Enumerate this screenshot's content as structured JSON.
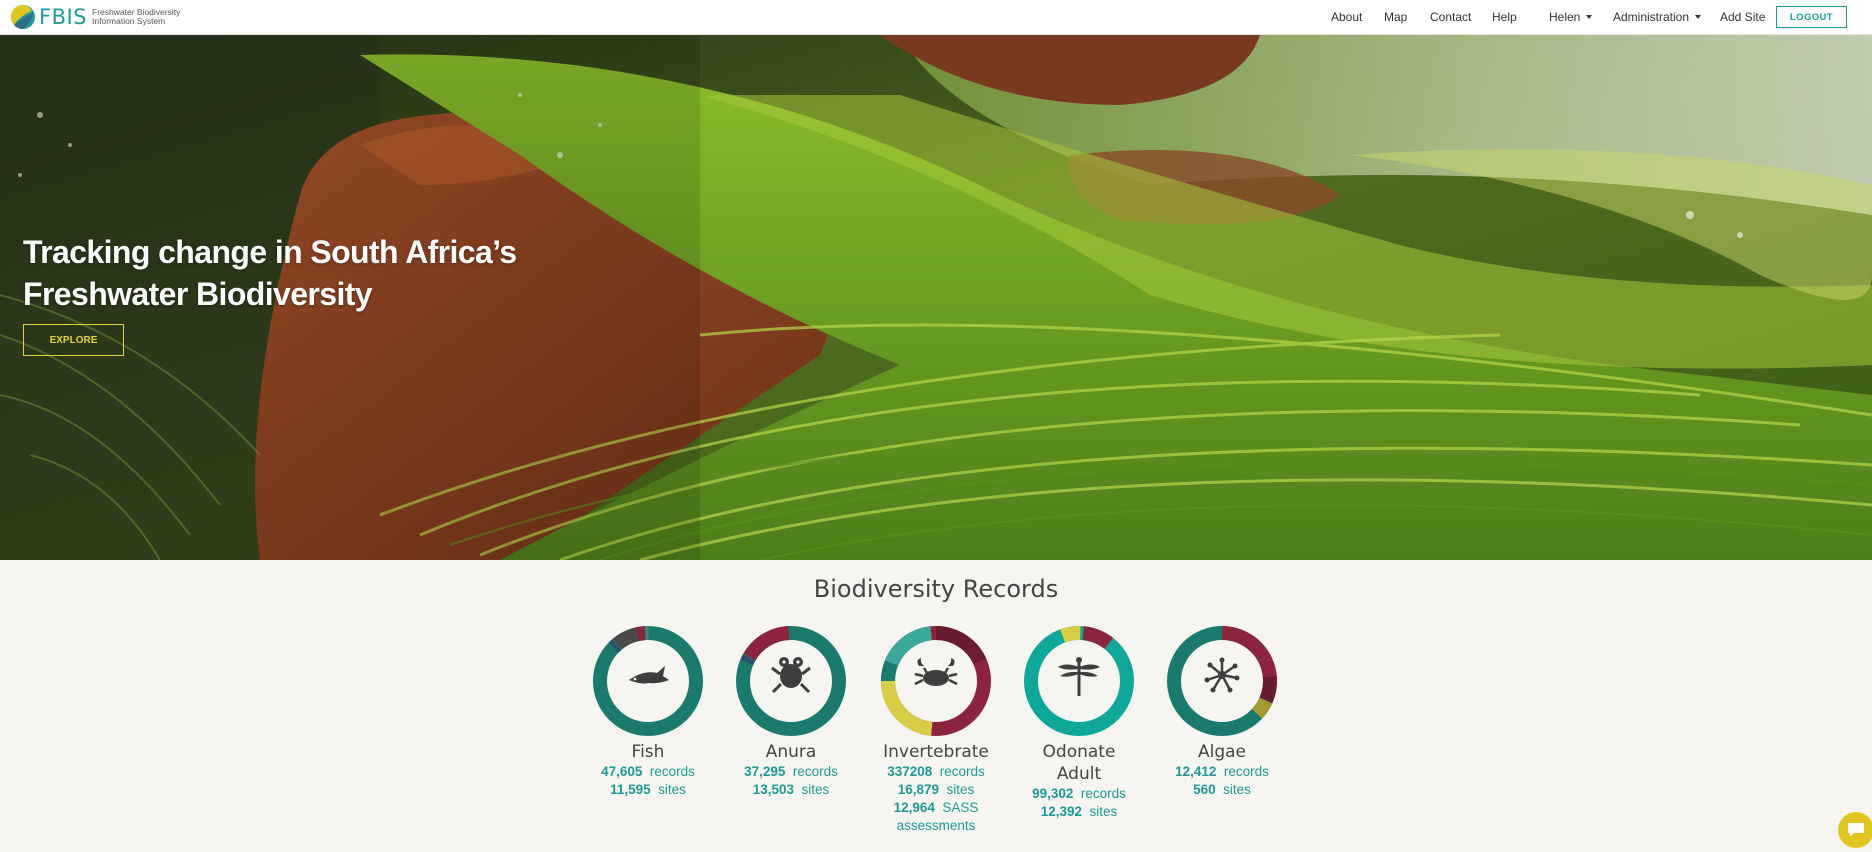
{
  "navbar": {
    "brand_acronym": "FBIS",
    "brand_line1": "Freshwater Biodiversity",
    "brand_line2": "Information System",
    "items": [
      {
        "label": "About"
      },
      {
        "label": "Map"
      },
      {
        "label": "Contact"
      },
      {
        "label": "Help"
      },
      {
        "label": "Helen"
      },
      {
        "label": "Administration"
      },
      {
        "label": "Add Site"
      }
    ],
    "logout_label": "LOGOUT"
  },
  "hero": {
    "title_line1": "Tracking change in South Africa’s",
    "title_line2": "Freshwater Biodiversity",
    "explore_label": "EXPLORE"
  },
  "stats": {
    "title": "Biodiversity Records",
    "cards": [
      {
        "name": "Fish",
        "icon": "fish-icon",
        "records": "47,605",
        "sites": "11,595"
      },
      {
        "name": "Anura",
        "icon": "frog-icon",
        "records": "37,295",
        "sites": "13,503"
      },
      {
        "name": "Invertebrate",
        "icon": "crab-icon",
        "records": "337208",
        "sites": "16,879",
        "sass": "12,964",
        "sass_label": "SASS",
        "sass_label2": "assessments"
      },
      {
        "name_line1": "Odonate",
        "name_line2": "Adult",
        "icon": "dragonfly-icon",
        "records": "99,302",
        "sites": "12,392"
      },
      {
        "name": "Algae",
        "icon": "algae-icon",
        "records": "12,412",
        "sites": "560"
      }
    ],
    "records_label": "records",
    "sites_label": "sites"
  },
  "colors": {
    "teal": "#1d9a97",
    "dark_teal": "#1b7a6e",
    "maroon": "#8c2440",
    "yellow": "#d8cd44",
    "accent_yellow": "#e1d13b"
  }
}
